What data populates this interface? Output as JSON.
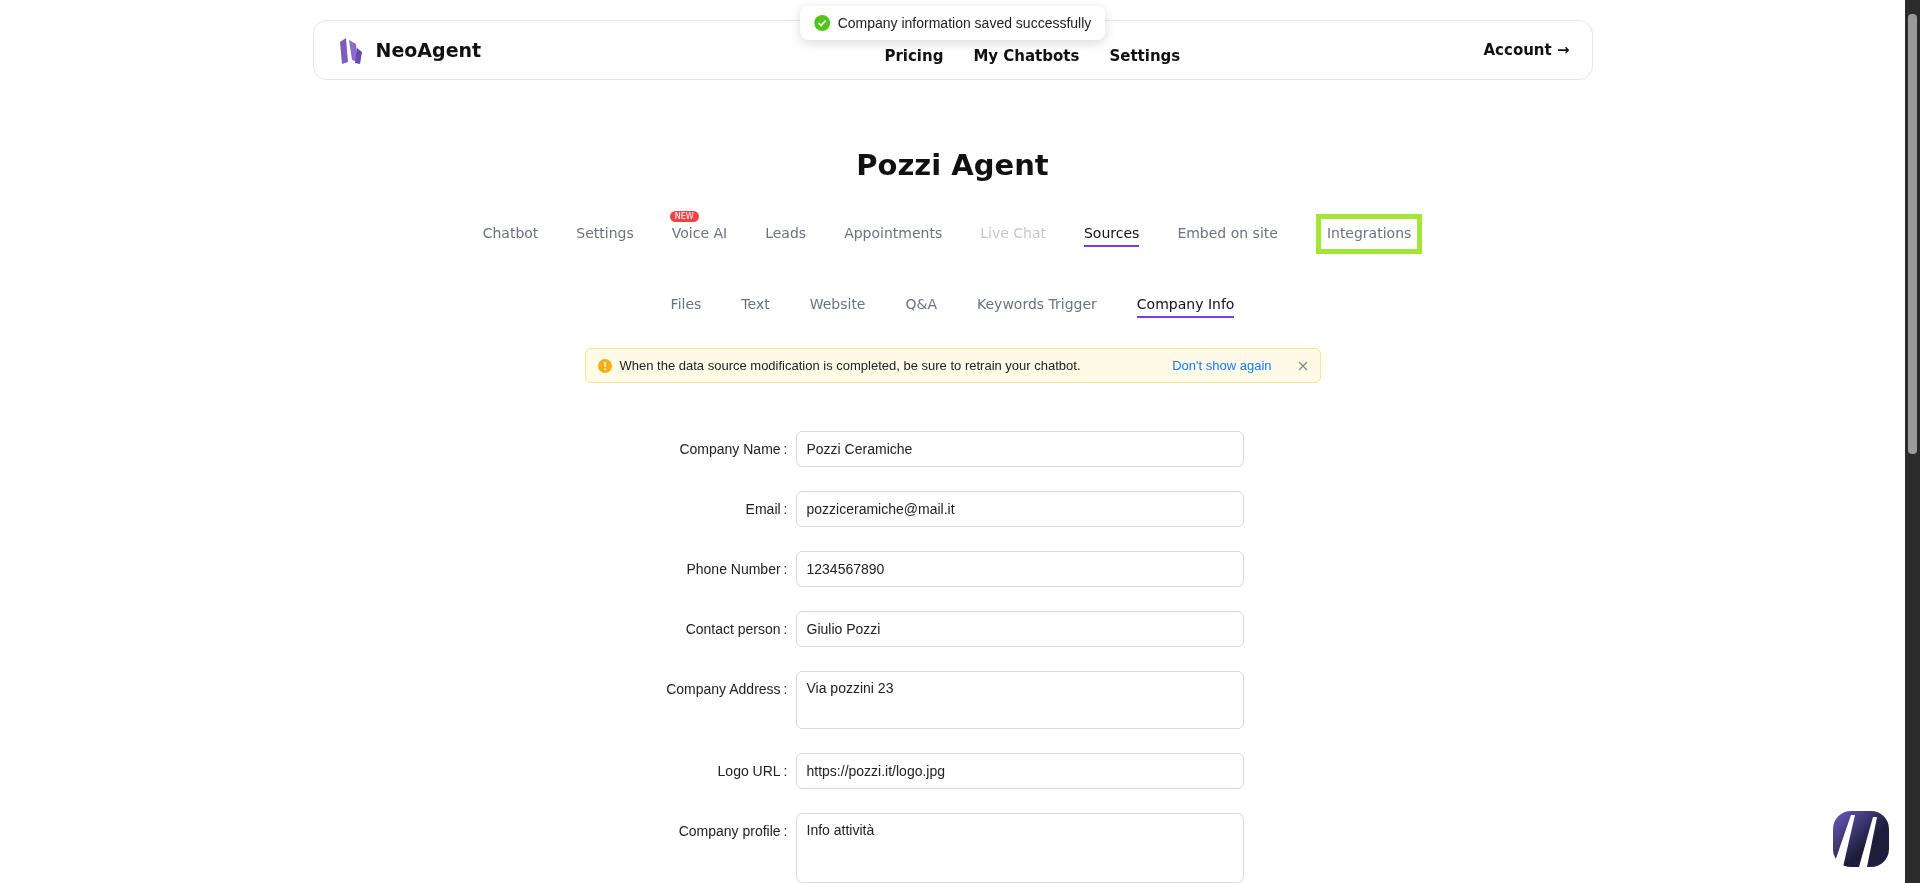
{
  "header": {
    "brand": "NeoAgent",
    "nav": [
      "Pricing",
      "My Chatbots",
      "Settings"
    ],
    "account": "Account →"
  },
  "toast": {
    "message": "Company information saved successfully"
  },
  "title": "Pozzi Agent",
  "tabs": [
    {
      "label": "Chatbot",
      "selected": false,
      "disabled": false
    },
    {
      "label": "Settings",
      "selected": false,
      "disabled": false
    },
    {
      "label": "Voice AI",
      "selected": false,
      "disabled": false,
      "badge": "NEW"
    },
    {
      "label": "Leads",
      "selected": false,
      "disabled": false
    },
    {
      "label": "Appointments",
      "selected": false,
      "disabled": false
    },
    {
      "label": "Live Chat",
      "selected": false,
      "disabled": true
    },
    {
      "label": "Sources",
      "selected": true,
      "disabled": false
    },
    {
      "label": "Embed on site",
      "selected": false,
      "disabled": false
    },
    {
      "label": "Integrations",
      "selected": false,
      "disabled": false,
      "highlighted": true
    }
  ],
  "subtabs": [
    {
      "label": "Files",
      "selected": false
    },
    {
      "label": "Text",
      "selected": false
    },
    {
      "label": "Website",
      "selected": false
    },
    {
      "label": "Q&A",
      "selected": false
    },
    {
      "label": "Keywords Trigger",
      "selected": false
    },
    {
      "label": "Company Info",
      "selected": true
    }
  ],
  "alert": {
    "message": "When the data source modification is completed, be sure to retrain your chatbot.",
    "link": "Don't show again"
  },
  "form": [
    {
      "label": "Company Name",
      "colon": ":",
      "value": "Pozzi Ceramiche",
      "kind": "input"
    },
    {
      "label": "Email",
      "colon": ":",
      "value": "pozziceramiche@mail.it",
      "kind": "input"
    },
    {
      "label": "Phone Number",
      "colon": ":",
      "value": "1234567890",
      "kind": "input"
    },
    {
      "label": "Contact person",
      "colon": ":",
      "value": "Giulio Pozzi",
      "kind": "input"
    },
    {
      "label": "Company Address",
      "colon": ":",
      "value": "Via pozzini 23",
      "kind": "textarea"
    },
    {
      "label": "Logo URL",
      "colon": ":",
      "value": "https://pozzi.it/logo.jpg",
      "kind": "input"
    },
    {
      "label": "Company profile",
      "colon": ":",
      "value": "Info attività",
      "kind": "textarea"
    }
  ]
}
